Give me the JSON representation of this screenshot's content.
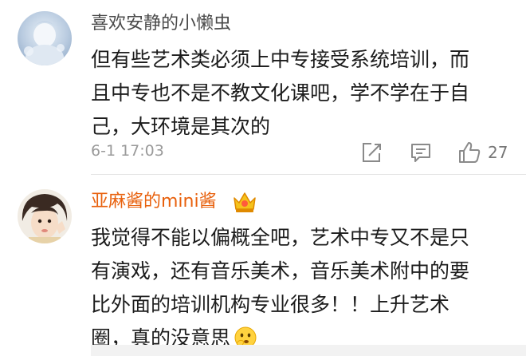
{
  "comments": [
    {
      "username": "喜欢安静的小懒虫",
      "lines": [
        "但有些艺术类必须上中专接受系统培训，而",
        "且中专也不是不教文化课吧，学不学在于自",
        "己，大环境是其次的"
      ],
      "timestamp": "6-1 17:03",
      "like_count": "27",
      "icons": {
        "share": "share-icon",
        "comment": "comment-icon",
        "like": "thumbs-up-icon"
      }
    },
    {
      "username": "亚麻酱的mini酱",
      "badge": "crown-badge-icon",
      "lines": [
        "我觉得不能以偏概全吧，艺术中专又不是只",
        "有演戏，还有音乐美术，音乐美术附中的要",
        "比外面的培训机构专业很多！！上升艺术",
        "圈，真的没意思"
      ],
      "trailing_emoji": "thinking-face-emoji",
      "colors": {
        "username": "#e8600c"
      }
    }
  ]
}
